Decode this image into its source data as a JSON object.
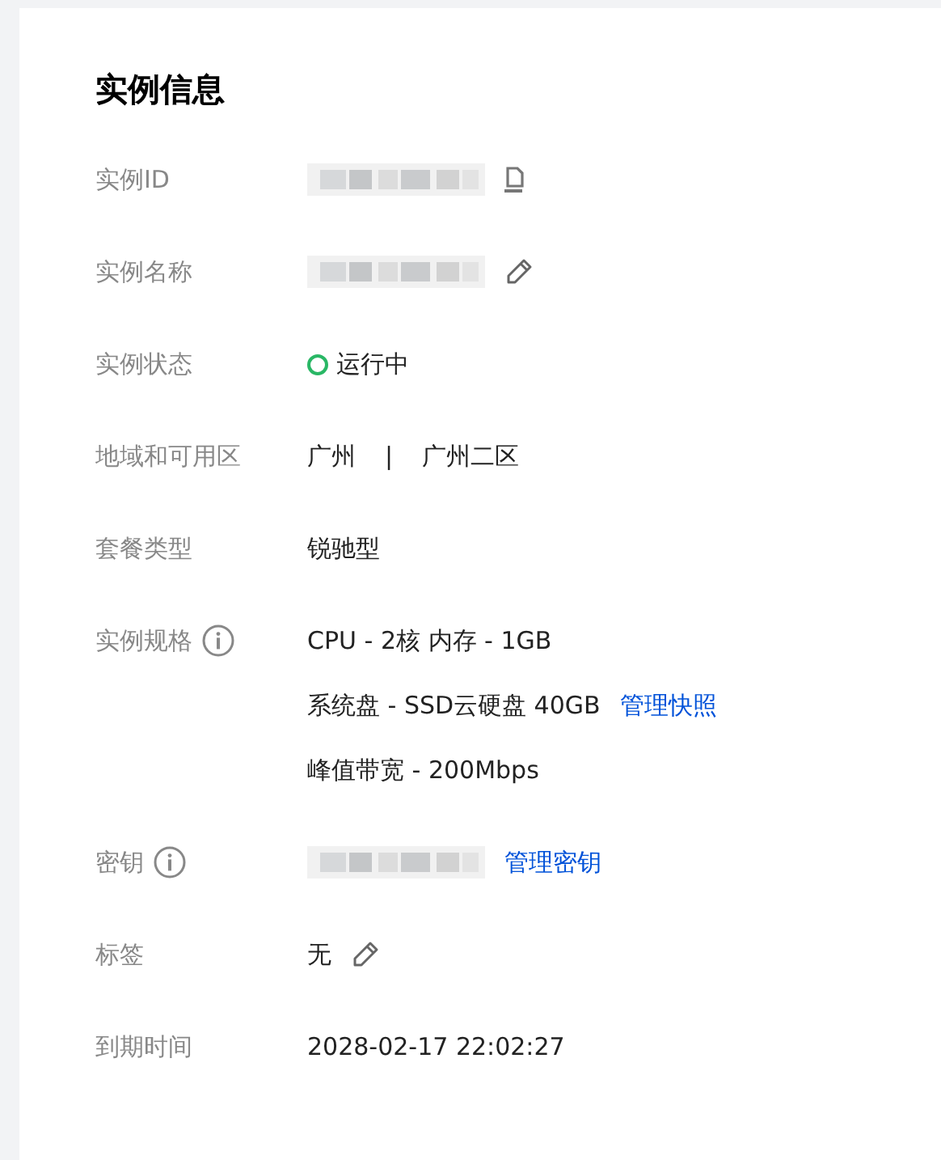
{
  "title": "实例信息",
  "rows": [
    {
      "label": "实例ID",
      "info": false,
      "lines": [
        [
          {
            "kind": "redacted"
          },
          {
            "kind": "copy"
          }
        ]
      ]
    },
    {
      "label": "实例名称",
      "info": false,
      "lines": [
        [
          {
            "kind": "redacted"
          },
          {
            "kind": "edit"
          }
        ]
      ]
    },
    {
      "label": "实例状态",
      "info": false,
      "lines": [
        [
          {
            "kind": "status",
            "text": "运行中",
            "color": "#29b765"
          }
        ]
      ]
    },
    {
      "label": "地域和可用区",
      "info": false,
      "lines": [
        [
          {
            "kind": "text",
            "text": "广州"
          },
          {
            "kind": "separator",
            "text": "|"
          },
          {
            "kind": "text",
            "text": "广州二区"
          }
        ]
      ]
    },
    {
      "label": "套餐类型",
      "info": false,
      "lines": [
        [
          {
            "kind": "text",
            "text": "锐驰型"
          }
        ]
      ]
    },
    {
      "label": "实例规格",
      "info": true,
      "lines": [
        [
          {
            "kind": "text",
            "text": "CPU - 2核 内存 - 1GB"
          }
        ],
        [
          {
            "kind": "text",
            "text": "系统盘 - SSD云硬盘 40GB"
          },
          {
            "kind": "link",
            "text": "管理快照"
          }
        ],
        [
          {
            "kind": "text",
            "text": "峰值带宽 - 200Mbps"
          }
        ]
      ]
    },
    {
      "label": "密钥",
      "info": true,
      "lines": [
        [
          {
            "kind": "redacted"
          },
          {
            "kind": "link",
            "text": "管理密钥"
          }
        ]
      ]
    },
    {
      "label": "标签",
      "info": false,
      "lines": [
        [
          {
            "kind": "text",
            "text": "无"
          },
          {
            "kind": "edit"
          }
        ]
      ]
    },
    {
      "label": "到期时间",
      "info": false,
      "lines": [
        [
          {
            "kind": "text",
            "text": "2028-02-17 22:02:27"
          }
        ]
      ]
    }
  ]
}
